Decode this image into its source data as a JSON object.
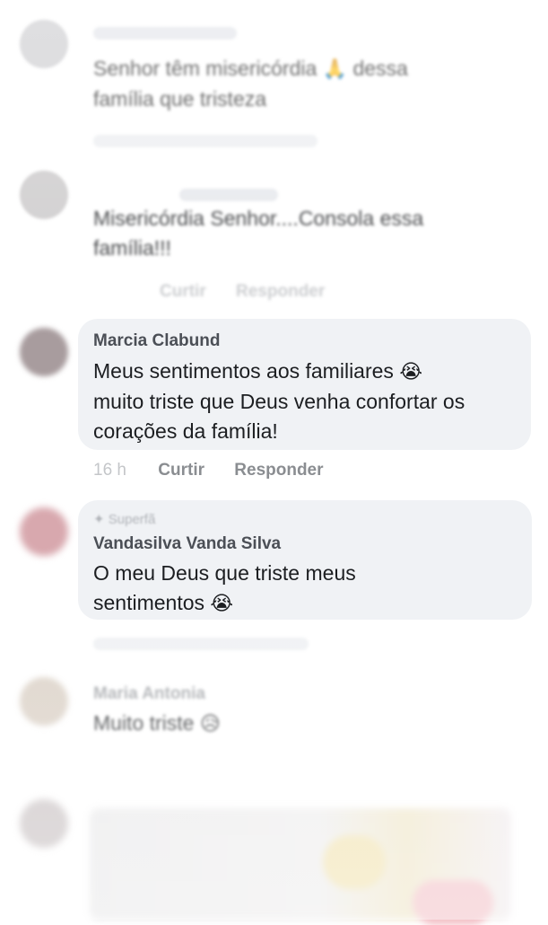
{
  "comments": [
    {
      "text": "Senhor têm misericórdia 🙏 dessa família que tristeza",
      "line1": "Senhor têm misericórdia",
      "emoji1": "🙏",
      "line1b": "dessa",
      "line2": "família que tristeza"
    },
    {
      "line1": "Misericórdia  Senhor....Consola essa",
      "line2": "família!!!",
      "actions": {
        "like": "Curtir",
        "reply": "Responder"
      }
    },
    {
      "author": "Marcia Clabund",
      "line1": "Meus sentimentos aos familiares",
      "emoji": "😭",
      "line2": "muito triste que Deus venha confortar os",
      "line3": "corações da família!",
      "time": "16 h",
      "actions": {
        "like": "Curtir",
        "reply": "Responder"
      }
    },
    {
      "badge": "Superfã",
      "author": "Vandasilva Vanda Silva",
      "line1": "O meu Deus que triste meus",
      "line2": "sentimentos",
      "emoji": "😭"
    },
    {
      "author": "Maria Antonia",
      "line1": "Muito triste",
      "emoji": "😥"
    }
  ],
  "colors": {
    "bubble": "#f0f2f5",
    "text": "#1c1e21",
    "meta": "#8a8d91"
  }
}
